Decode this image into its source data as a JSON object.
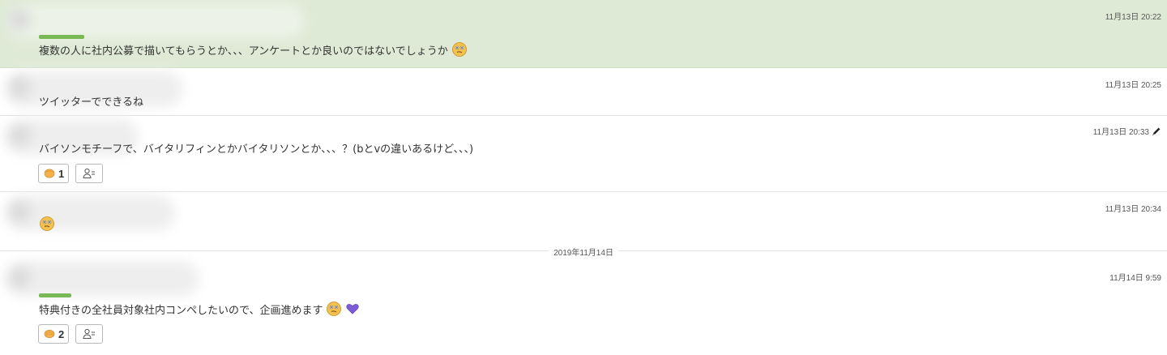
{
  "messages": [
    {
      "timestamp": "11月13日 20:22",
      "text": "複数の人に社内公募で描いてもらうとか、、、アンケートとか良いのではないでしょうか",
      "emoji": "thinking-face",
      "highlighted": true
    },
    {
      "timestamp": "11月13日 20:25",
      "text": "ツイッターでできるね"
    },
    {
      "timestamp": "11月13日 20:33",
      "edited_icon": "pencil-icon",
      "text": "バイソンモチーフで、バイタリフィンとかバイタリソンとか、、、？(bとvの違いあるけど、、、)",
      "reactions": [
        {
          "icon": "clap-hands",
          "count": "1"
        }
      ]
    },
    {
      "timestamp": "11月13日 20:34",
      "emoji": "thinking-face"
    },
    {
      "timestamp": "11月14日 9:59",
      "text": "特典付きの全社員対象社内コンペしたいので、企画進めます",
      "emoji": "thinking-face",
      "emoji2": "purple-heart",
      "reactions": [
        {
          "icon": "clap-hands",
          "count": "2"
        }
      ]
    }
  ],
  "date_separator": "2019年11月14日",
  "colors": {
    "highlight_bg": "#dfead6",
    "heart": "#7b5bd6",
    "emoji_face": "#f4c04e"
  }
}
